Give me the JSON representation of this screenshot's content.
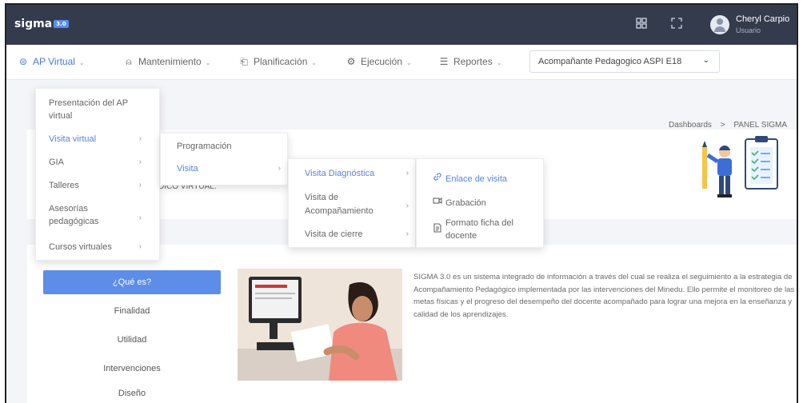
{
  "brand": {
    "name": "sigma",
    "badge": "3.0"
  },
  "header": {
    "user_name": "Cheryl Carpio",
    "user_role": "Usuario"
  },
  "menu": {
    "ap_virtual": "AP Virtual",
    "mantenimiento": "Mantenimiento",
    "planificacion": "Planificación",
    "ejecucion": "Ejecución",
    "reportes": "Reportes",
    "profile_select": "Acompañante Pedagogico ASPI E18"
  },
  "dropdown_l1": {
    "items": [
      "Presentación del AP virtual",
      "Visita virtual",
      "GIA",
      "Talleres",
      "Asesorías pedagógicas",
      "Cursos virtuales"
    ]
  },
  "dropdown_l2": {
    "items": [
      "Programación",
      "Visita"
    ]
  },
  "dropdown_l3": {
    "items": [
      "Visita Diagnóstica",
      "Visita de Acompañamiento",
      "Visita de cierre"
    ]
  },
  "dropdown_l4": {
    "items": [
      "Enlace de visita",
      "Grabación",
      "Formato ficha del docente"
    ]
  },
  "breadcrumb": {
    "first": "Dashboards",
    "sep": ">",
    "second": "PANEL SIGMA"
  },
  "hero": {
    "partial_title": "DICO VIRTUAL."
  },
  "sidebar": {
    "items": [
      "¿Qué es?",
      "Finalidad",
      "Utilidad",
      "Intervenciones",
      "Diseño"
    ]
  },
  "description": "SIGMA 3.0 es un sistema integrado de información a través del cual se realiza el seguimiento a la estrategia de Acompañamiento Pedagógico implementada por las intervenciones del Minedu. Ello permite el monitoreo de las metas físicas y el progreso del desempeño del docente acompañado para lograr una mejora en la enseñanza y calidad de los aprendizajes.",
  "colors": {
    "topbar": "#343b4d",
    "accent": "#5c8de9",
    "link": "#4a78d6"
  }
}
